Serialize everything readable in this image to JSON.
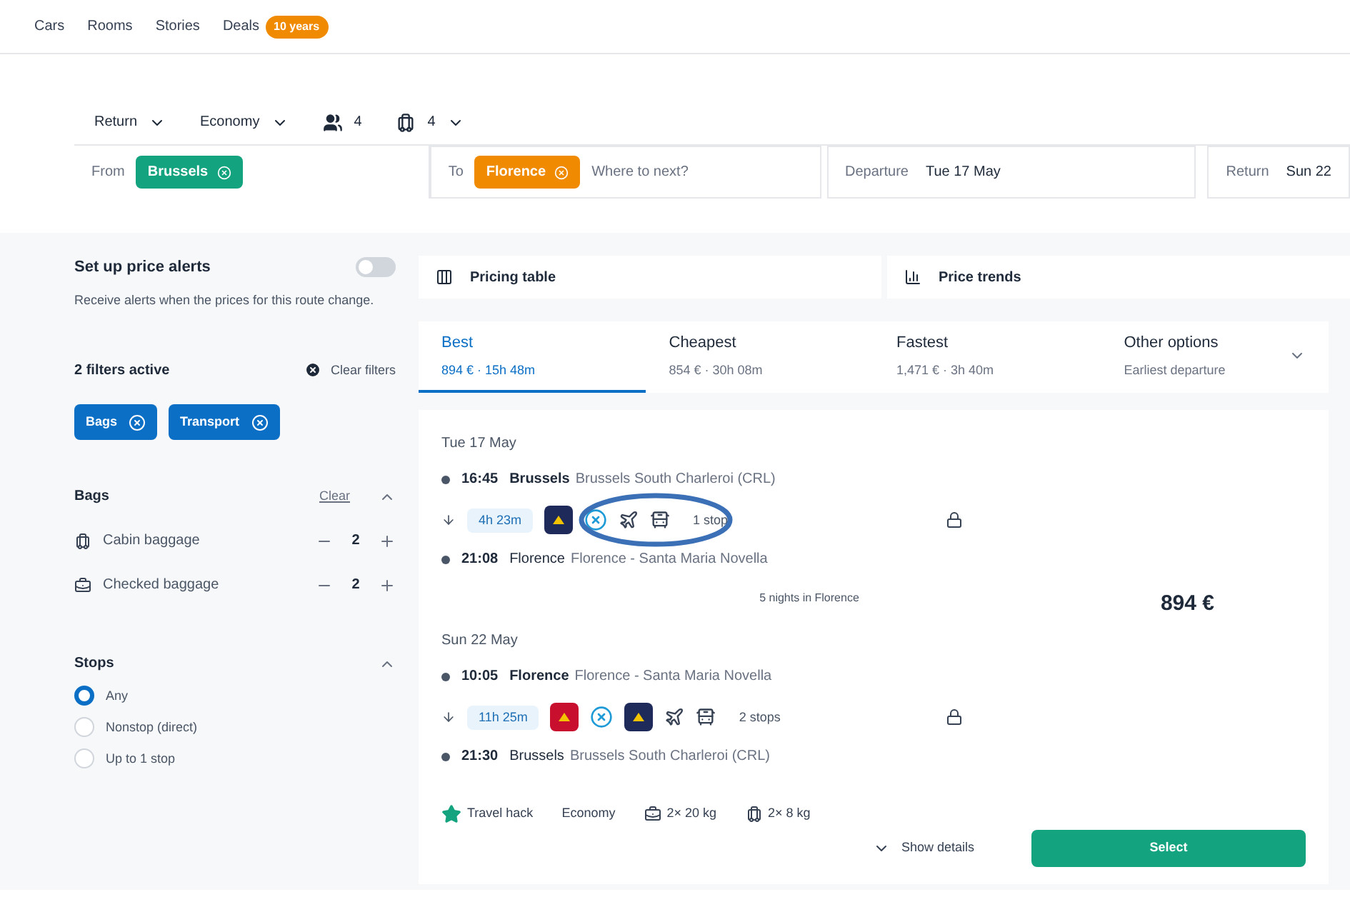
{
  "nav": [
    {
      "label": "Cars"
    },
    {
      "label": "Rooms"
    },
    {
      "label": "Stories"
    },
    {
      "label": "Deals",
      "badge": "10 years"
    }
  ],
  "search": {
    "trip_type": "Return",
    "cabin": "Economy",
    "passengers": "4",
    "bags": "4",
    "from_label": "From",
    "from_chip": "Brussels",
    "to_label": "To",
    "to_chip": "Florence",
    "to_placeholder": "Where to next?",
    "departure_label": "Departure",
    "departure_value": "Tue 17 May",
    "return_label": "Return",
    "return_value": "Sun 22"
  },
  "price_alerts": {
    "title": "Set up price alerts",
    "on": false,
    "description": "Receive alerts when the prices for this route change."
  },
  "filters": {
    "count_label": "2 filters active",
    "clear_label": "Clear filters",
    "chips": [
      {
        "label": "Bags"
      },
      {
        "label": "Transport"
      }
    ]
  },
  "bags": {
    "title": "Bags",
    "clear": "Clear",
    "expanded": true,
    "items": [
      {
        "kind": "cabin",
        "label": "Cabin baggage",
        "value": "2"
      },
      {
        "kind": "checked",
        "label": "Checked baggage",
        "value": "2"
      }
    ]
  },
  "stops": {
    "title": "Stops",
    "expanded": true,
    "options": [
      {
        "label": "Any",
        "selected": true
      },
      {
        "label": "Nonstop (direct)",
        "selected": false
      },
      {
        "label": "Up to 1 stop",
        "selected": false
      }
    ]
  },
  "views": [
    {
      "kind": "table",
      "label": "Pricing table"
    },
    {
      "kind": "trends",
      "label": "Price trends"
    }
  ],
  "sort_tabs": [
    {
      "label": "Best",
      "detail": "894 € · 15h 48m",
      "selected": true
    },
    {
      "label": "Cheapest",
      "detail": "854 € · 30h 08m",
      "selected": false
    },
    {
      "label": "Fastest",
      "detail": "1,471 € · 3h 40m",
      "selected": false
    },
    {
      "label": "Other options",
      "detail": "Earliest departure",
      "selected": false
    }
  ],
  "result": {
    "legs": [
      {
        "date": "Tue 17 May",
        "dep_time": "16:45",
        "dep_city": "Brussels",
        "dep_station": "Brussels South Charleroi (CRL)",
        "duration": "4h 23m",
        "icons": [
          {
            "kind": "logo",
            "color": "#1e2a5a"
          },
          {
            "kind": "transfer"
          },
          {
            "kind": "plane"
          },
          {
            "kind": "bus"
          }
        ],
        "stops": "1 stop",
        "arr_time": "21:08",
        "arr_city": "Florence",
        "arr_station": "Florence - Santa Maria Novella"
      },
      {
        "date": "Sun 22 May",
        "dep_time": "10:05",
        "dep_city": "Florence",
        "dep_station": "Florence - Santa Maria Novella",
        "duration": "11h 25m",
        "icons": [
          {
            "kind": "logo",
            "color": "#c8102e"
          },
          {
            "kind": "transfer"
          },
          {
            "kind": "logo",
            "color": "#1e2a5a"
          },
          {
            "kind": "plane"
          },
          {
            "kind": "bus"
          }
        ],
        "stops": "2 stops",
        "arr_time": "21:30",
        "arr_city": "Brussels",
        "arr_station": "Brussels South Charleroi (CRL)"
      }
    ],
    "stay": "5 nights in Florence",
    "price": "894 €",
    "tags": [
      {
        "kind": "star",
        "label": "Travel hack"
      },
      {
        "kind": "plain",
        "label": "Economy"
      },
      {
        "kind": "checked",
        "label": "2× 20 kg"
      },
      {
        "kind": "cabin",
        "label": "2× 8 kg"
      }
    ],
    "details": "Show details",
    "select": "Select"
  }
}
